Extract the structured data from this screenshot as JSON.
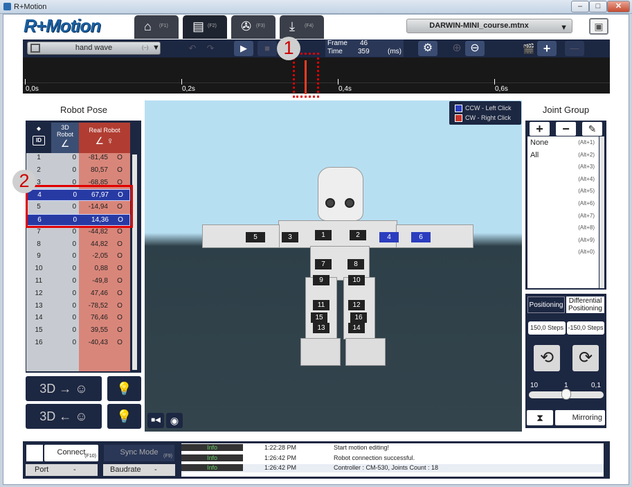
{
  "window": {
    "title": "R+Motion",
    "min": "–",
    "max": "□",
    "close": "✕"
  },
  "app": {
    "logo": "R+Motion"
  },
  "tabs": [
    {
      "icon": "home-icon",
      "glyph": "⌂",
      "key": "(F1)"
    },
    {
      "icon": "film-icon",
      "glyph": "▤",
      "key": "(F2)"
    },
    {
      "icon": "reel-icon",
      "glyph": "✇",
      "key": "(F3)"
    },
    {
      "icon": "download-icon",
      "glyph": "⤓",
      "key": "(F4)"
    }
  ],
  "file": {
    "name": "DARWIN-MINI_course.mtnx",
    "arrow": "▼"
  },
  "save": {
    "glyph": "▣"
  },
  "toolbar": {
    "motion": "hand wave",
    "motion_suffix": "(--)",
    "motion_arrow": "▼",
    "undo": "↶",
    "redo": "↷",
    "play": "▶",
    "stop": "■",
    "frame_label": "Frame",
    "frame_value": "46",
    "time_label": "Time",
    "time_value": "359",
    "time_unit": "(ms)",
    "settings": "⚙",
    "zoom_in": "⊕",
    "zoom_out": "⊖",
    "clapper": "🎬",
    "add": "+",
    "remove": "—"
  },
  "timeline": {
    "ticks": [
      "0,0s",
      "0,2s",
      "0,4s",
      "0,6s"
    ]
  },
  "annotations": {
    "one": "1",
    "two": "2"
  },
  "robot_pose": {
    "title": "Robot Pose",
    "col_id": "ID",
    "col_3d": "3D Robot",
    "col_real": "Real Robot",
    "col_dot": "◆",
    "rows": [
      {
        "id": "1",
        "v3d": "0",
        "real": "-81,45",
        "led": "O"
      },
      {
        "id": "2",
        "v3d": "0",
        "real": "80,57",
        "led": "O"
      },
      {
        "id": "3",
        "v3d": "0",
        "real": "-68,85",
        "led": "O"
      },
      {
        "id": "4",
        "v3d": "0",
        "real": "67,97",
        "led": "O"
      },
      {
        "id": "5",
        "v3d": "0",
        "real": "-14,94",
        "led": "O"
      },
      {
        "id": "6",
        "v3d": "0",
        "real": "14,36",
        "led": "O"
      },
      {
        "id": "7",
        "v3d": "0",
        "real": "-44,82",
        "led": "O"
      },
      {
        "id": "8",
        "v3d": "0",
        "real": "44,82",
        "led": "O"
      },
      {
        "id": "9",
        "v3d": "0",
        "real": "-2,05",
        "led": "O"
      },
      {
        "id": "10",
        "v3d": "0",
        "real": "0,88",
        "led": "O"
      },
      {
        "id": "11",
        "v3d": "0",
        "real": "-49,8",
        "led": "O"
      },
      {
        "id": "12",
        "v3d": "0",
        "real": "47,46",
        "led": "O"
      },
      {
        "id": "13",
        "v3d": "0",
        "real": "-78,52",
        "led": "O"
      },
      {
        "id": "14",
        "v3d": "0",
        "real": "76,46",
        "led": "O"
      },
      {
        "id": "15",
        "v3d": "0",
        "real": "39,55",
        "led": "O"
      },
      {
        "id": "16",
        "v3d": "0",
        "real": "-40,43",
        "led": "O"
      }
    ],
    "btn_3d_to_real": "3D → ☺",
    "btn_real_to_3d": "3D ← ☺",
    "btn_light_on": "💡",
    "btn_light_off": "💡"
  },
  "viewport": {
    "legend_ccw": "CCW  - Left Click",
    "legend_cw": "CW    - Right Click",
    "ccw_color": "#2b3dbf",
    "cw_color": "#c7342a",
    "joints": [
      "1",
      "2",
      "3",
      "4",
      "5",
      "6",
      "7",
      "8",
      "9",
      "10",
      "11",
      "12",
      "13",
      "14",
      "15",
      "16"
    ],
    "camera": "■◀",
    "snapshot": "◉"
  },
  "joint_group": {
    "title": "Joint Group",
    "add": "+",
    "remove": "−",
    "edit": "✎",
    "items": [
      {
        "label": "None",
        "key": "(Alt+1)"
      },
      {
        "label": "All",
        "key": "(Alt+2)"
      },
      {
        "label": "",
        "key": "(Alt+3)"
      },
      {
        "label": "",
        "key": "(Alt+4)"
      },
      {
        "label": "",
        "key": "(Alt+5)"
      },
      {
        "label": "",
        "key": "(Alt+6)"
      },
      {
        "label": "",
        "key": "(Alt+7)"
      },
      {
        "label": "",
        "key": "(Alt+8)"
      },
      {
        "label": "",
        "key": "(Alt+9)"
      },
      {
        "label": "",
        "key": "(Alt+0)"
      }
    ]
  },
  "positioning": {
    "tab1": "Positioning",
    "tab2": "Differential Positioning",
    "steps_ccw": "150,0  Steps",
    "steps_cw": "-150,0  Steps",
    "rot_ccw": "⟲",
    "rot_cw": "⟳",
    "scale_min": "10",
    "scale_mid": "1",
    "scale_max": "0,1",
    "mirror_icon": "⧗",
    "mirroring": "Mirroring"
  },
  "status": {
    "connect": "Connect",
    "connect_key": "(F10)",
    "sync": "Sync Mode",
    "sync_key": "(F9)",
    "port": "Port",
    "port_val": "-",
    "baud": "Baudrate",
    "baud_val": "-",
    "log": [
      {
        "level": "Info",
        "time": "1:22:28 PM",
        "msg": "Start motion editing!"
      },
      {
        "level": "Info",
        "time": "1:26:42 PM",
        "msg": "Robot connection successful."
      },
      {
        "level": "Info",
        "time": "1:26:42 PM",
        "msg": "Controller : CM-530, Joints Count : 18"
      }
    ]
  }
}
